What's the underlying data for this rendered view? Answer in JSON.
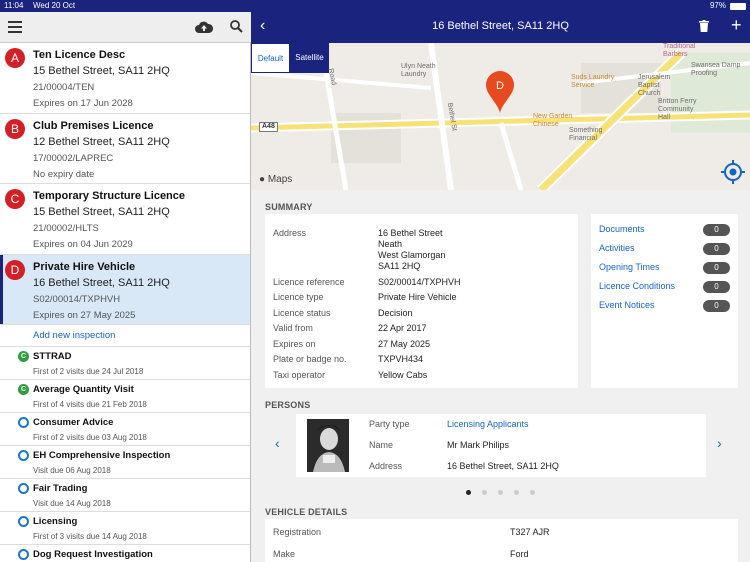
{
  "status": {
    "time": "11:04",
    "date": "Wed 20 Oct",
    "battery": "97%"
  },
  "licences": [
    {
      "badge": "A",
      "name": "Ten Licence Desc",
      "address": "15 Bethel Street, SA11 2HQ",
      "ref": "21/00004/TEN",
      "expiry": "Expires on 17 Jun 2028"
    },
    {
      "badge": "B",
      "name": "Club Premises Licence",
      "address": "12 Bethel Street, SA11 2HQ",
      "ref": "17/00002/LAPREC",
      "expiry": "No expiry date"
    },
    {
      "badge": "C",
      "name": "Temporary Structure Licence",
      "address": "15 Bethel Street, SA11 2HQ",
      "ref": "21/00002/HLTS",
      "expiry": "Expires on 04 Jun 2029"
    },
    {
      "badge": "D",
      "name": "Private Hire Vehicle",
      "address": "16 Bethel Street, SA11 2HQ",
      "ref": "S02/00014/TXPHVH",
      "expiry": "Expires on 27 May 2025"
    }
  ],
  "add_inspection": "Add new inspection",
  "inspections": [
    {
      "icon": "C",
      "name": "STTRAD",
      "sub": "First of 2 visits due 24 Jul 2018"
    },
    {
      "icon": "C",
      "name": "Average Quantity Visit",
      "sub": "First of 4 visits due 21 Feb 2018"
    },
    {
      "icon": "",
      "name": "Consumer Advice",
      "sub": "First of 2 visits due 03 Aug 2018"
    },
    {
      "icon": "",
      "name": "EH Comprehensive Inspection",
      "sub": "Visit due 06 Aug 2018"
    },
    {
      "icon": "",
      "name": "Fair Trading",
      "sub": "Visit due 14 Aug 2018"
    },
    {
      "icon": "",
      "name": "Licensing",
      "sub": "First of 3 visits due 14 Aug 2018"
    },
    {
      "icon": "",
      "name": "Dog Request Investigation",
      "sub": ""
    }
  ],
  "header": {
    "title": "16 Bethel Street, SA11 2HQ"
  },
  "map": {
    "tab_default": "Default",
    "tab_satellite": "Satellite",
    "pin_label": "D",
    "provider": "Maps",
    "labels": {
      "ulyn": "Ulyn Neath\nLaundry",
      "suds": "Suds Laundry\nService",
      "traditional": "Traditional\nBarbers",
      "jerusalem": "Jerusalem\nBaptist\nChurch",
      "swansea": "Swansea Damp\nProofing",
      "britton": "Britton Ferry\nCommunity\nHall",
      "newgarden": "New Garden\nChinese",
      "something": "Something\nFinancial",
      "a48": "A48",
      "bethel": "Bethel St",
      "road": "Road"
    }
  },
  "summary": {
    "heading": "SUMMARY",
    "fields": [
      {
        "label": "Address",
        "value": "16 Bethel Street\nNeath\nWest Glamorgan\nSA11 2HQ"
      },
      {
        "label": "Licence reference",
        "value": "S02/00014/TXPHVH"
      },
      {
        "label": "Licence type",
        "value": "Private Hire Vehicle"
      },
      {
        "label": "Licence status",
        "value": "Decision"
      },
      {
        "label": "Valid from",
        "value": "22 Apr 2017"
      },
      {
        "label": "Expires on",
        "value": "27 May 2025"
      },
      {
        "label": "Plate or badge no.",
        "value": "TXPVH434"
      },
      {
        "label": "Taxi operator",
        "value": "Yellow Cabs"
      }
    ],
    "side_links": [
      {
        "label": "Documents",
        "count": "0"
      },
      {
        "label": "Activities",
        "count": "0"
      },
      {
        "label": "Opening Times",
        "count": "0"
      },
      {
        "label": "Licence Conditions",
        "count": "0"
      },
      {
        "label": "Event Notices",
        "count": "0"
      }
    ]
  },
  "persons": {
    "heading": "PERSONS",
    "party_type_label": "Party type",
    "party_type": "Licensing Applicants",
    "name_label": "Name",
    "name": "Mr Mark Philips",
    "address_label": "Address",
    "address": "16 Bethel Street, SA11 2HQ"
  },
  "vehicle": {
    "heading": "VEHICLE DETAILS",
    "registration_label": "Registration",
    "registration": "T327 AJR",
    "make_label": "Make",
    "make": "Ford"
  }
}
